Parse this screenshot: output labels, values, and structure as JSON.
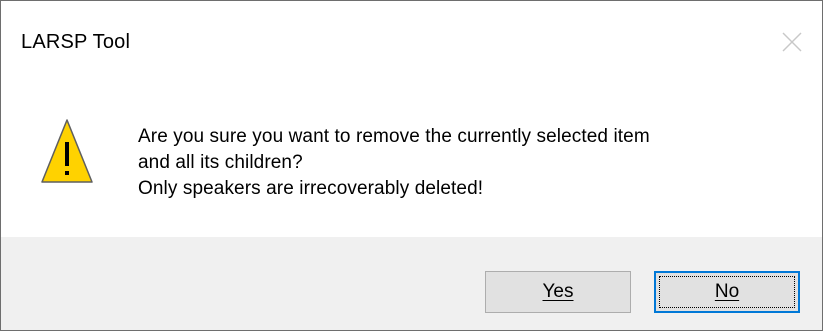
{
  "window": {
    "title": "LARSP Tool"
  },
  "icons": {
    "close": "close-icon",
    "warning": "warning-icon"
  },
  "colors": {
    "warning_fill": "#FFD200",
    "focus_border": "#0078D7",
    "button_face": "#E1E1E1",
    "footer_background": "#F0F0F0"
  },
  "message": {
    "line1": "Are you sure you want to remove the currently selected item",
    "line2": "and all its children?",
    "line3": "Only speakers are irrecoverably deleted!"
  },
  "buttons": {
    "yes_label": "Yes",
    "no_label": "No",
    "focused": "No"
  }
}
